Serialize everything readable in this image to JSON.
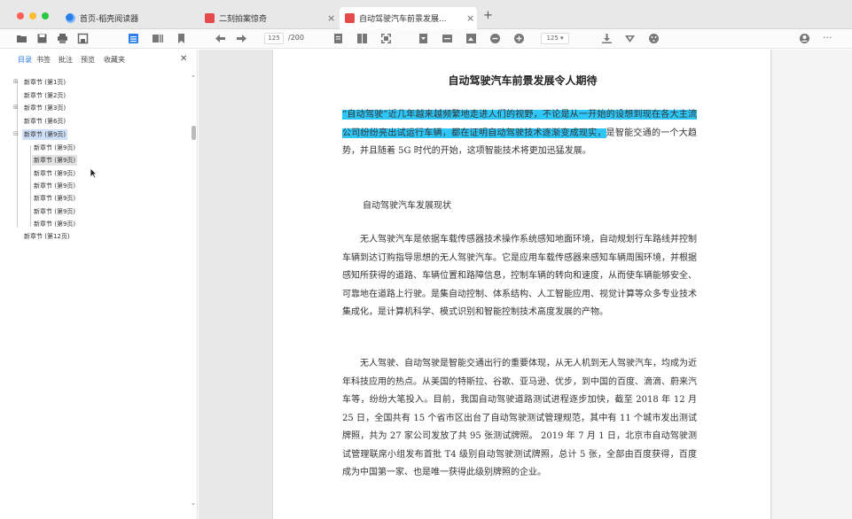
{
  "tabs": [
    {
      "label": "首页-稻壳阅读器",
      "active": false
    },
    {
      "label": "二刻拍案惊奇",
      "active": false
    },
    {
      "label": "自动驾驶汽车前景发展...",
      "active": true
    }
  ],
  "toolbar": {
    "current_page": "125",
    "total_pages": "/200",
    "zoom": "125",
    "zoom_arrow": "▾"
  },
  "sidebar": {
    "tabs": [
      "目录",
      "书签",
      "批注",
      "预览",
      "收藏夹"
    ],
    "close": "✕",
    "toc": [
      {
        "label": "新章节 (第1页)",
        "expander": "⊞"
      },
      {
        "label": "新章节 (第2页)",
        "expander": ""
      },
      {
        "label": "新章节 (第3页)",
        "expander": "⊞"
      },
      {
        "label": "新章节 (第6页)",
        "expander": ""
      },
      {
        "label": "新章节 (第9页)",
        "expander": "⊟"
      },
      {
        "label": "新章节 (第9页)",
        "expander": ""
      },
      {
        "label": "新章节 (第9页)",
        "expander": ""
      },
      {
        "label": "新章节 (第9页)",
        "expander": ""
      },
      {
        "label": "新章节 (第9页)",
        "expander": ""
      },
      {
        "label": "新章节 (第9页)",
        "expander": ""
      },
      {
        "label": "新章节 (第9页)",
        "expander": ""
      },
      {
        "label": "新章节 (第9页)",
        "expander": ""
      },
      {
        "label": "新章节 (第12页)",
        "expander": ""
      }
    ]
  },
  "document": {
    "title": "自动驾驶汽车前景发展令人期待",
    "p1_highlight": "“自动驾驶”近几年越来越频繁地走进人们的视野，不论是从一开始的设想到现在各大主流公司纷纷亮出试运行车辆，都在证明自动驾驶技术逐渐变成现实，",
    "p1_rest": "是智能交通的一个大趋势，并且随着 5G 时代的开始，这项智能技术将更加迅猛发展。",
    "subhead": "自动驾驶汽车发展现状",
    "p2": "无人驾驶汽车是依据车载传感器技术操作系统感知地面环境，自动规划行车路线并控制车辆到达订购指导思想的无人驾驶汽车。它是应用车载传感器来感知车辆周围环境，并根据感知所获得的道路、车辆位置和路障信息，控制车辆的转向和速度，从而使车辆能够安全、可靠地在道路上行驶。是集自动控制、体系结构、人工智能应用、视觉计算等众多专业技术集成化，是计算机科学、模式识别和智能控制技术高度发展的产物。",
    "p3": "无人驾驶、自动驾驶是智能交通出行的重要体现，从无人机到无人驾驶汽车，均成为近年科技应用的热点。从美国的特斯拉、谷歌、亚马逊、优步，到中国的百度、滴滴、蔚来汽车等，纷纷大笔投入。目前，我国自动驾驶道路测试进程逐步加快，截至 2018 年 12 月 25 日，全国共有 15 个省市区出台了自动驾驶测试管理规范，其中有 11 个城市发出测试牌照，共为 27 家公司发放了共 95 张测试牌照。 2019 年 7 月 1 日，北京市自动驾驶测试管理联席小组发布首批 T4 级别自动驾驶测试牌照，总计 5 张，全部由百度获得，百度成为中国第一家、也是唯一获得此级别牌照的企业。"
  }
}
